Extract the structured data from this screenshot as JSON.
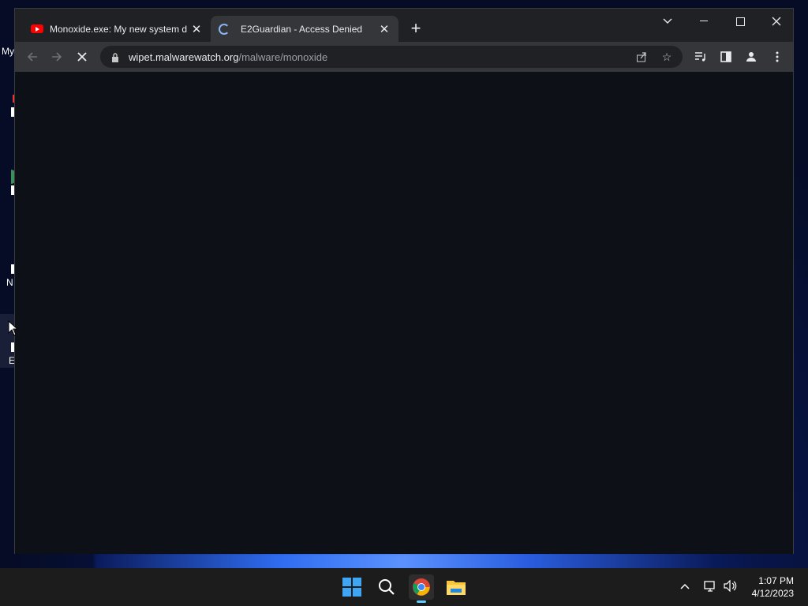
{
  "desktop": {
    "icons": [
      {
        "label": "My"
      },
      {
        "label": "N"
      },
      {
        "label": "E"
      }
    ]
  },
  "browser": {
    "tabs": [
      {
        "title": "Monoxide.exe: My new system d",
        "icon": "youtube-icon",
        "active": false
      },
      {
        "title": "E2Guardian - Access Denied",
        "icon": "loading-spinner-icon",
        "active": true
      }
    ],
    "new_tab_label": "+",
    "address": {
      "host": "wipet.malwarewatch.org",
      "path": "/malware/monoxide"
    }
  },
  "taskbar": {
    "time": "1:07 PM",
    "date": "4/12/2023"
  },
  "colors": {
    "content_bg": "#0d1117",
    "chrome_dark": "#202124",
    "toolbar": "#35363a",
    "taskbar": "#1c1c1c"
  }
}
